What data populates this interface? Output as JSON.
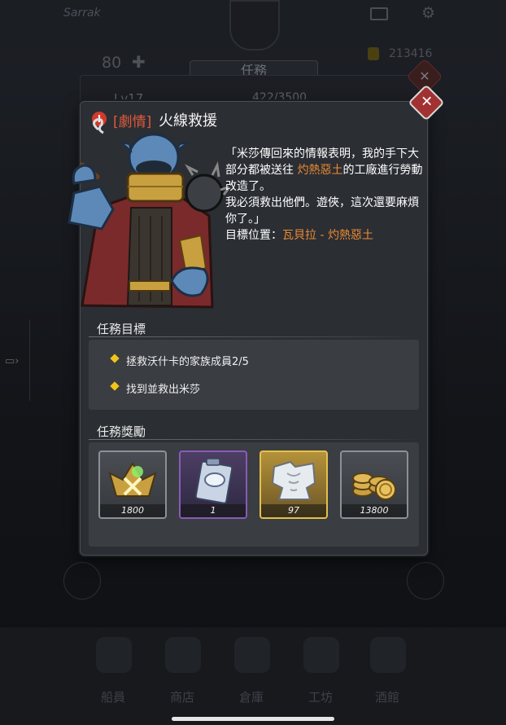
{
  "background": {
    "player_name": "Sarrak",
    "energy": "80",
    "coins": "213416",
    "screen_title": "任務",
    "level": "Lv17",
    "exp": "422/3500",
    "nav": [
      "船員",
      "商店",
      "倉庫",
      "工坊",
      "酒館"
    ]
  },
  "quest": {
    "category": "[劇情]",
    "title": "火線救援",
    "story_part1": "「米莎傳回來的情報表明，我的手下大部分都被送往 ",
    "story_place1": "灼熱惡土",
    "story_part2": "的工廠進行勞動改造了。",
    "story_part3": "我必須救出他們。遊俠，這次還要麻煩你了。」",
    "location_label": "目標位置：",
    "location_value": "瓦貝拉 - 灼熱惡土",
    "objectives_title": "任務目標",
    "objectives": [
      "拯救沃什卡的家族成員2/5",
      "找到並救出米莎"
    ],
    "rewards_title": "任務獎勵",
    "rewards": [
      {
        "name": "crew-badge",
        "qty": "1800",
        "rarity": "common"
      },
      {
        "name": "blueprint",
        "qty": "1",
        "rarity": "rare"
      },
      {
        "name": "armor-fragment",
        "qty": "97",
        "rarity": "epic"
      },
      {
        "name": "gold-coins",
        "qty": "13800",
        "rarity": "common"
      }
    ]
  },
  "colors": {
    "accent_orange": "#ec8a33",
    "category_red": "#e05a3a",
    "close_red": "#a23232",
    "bullet_yellow": "#f0c419"
  }
}
